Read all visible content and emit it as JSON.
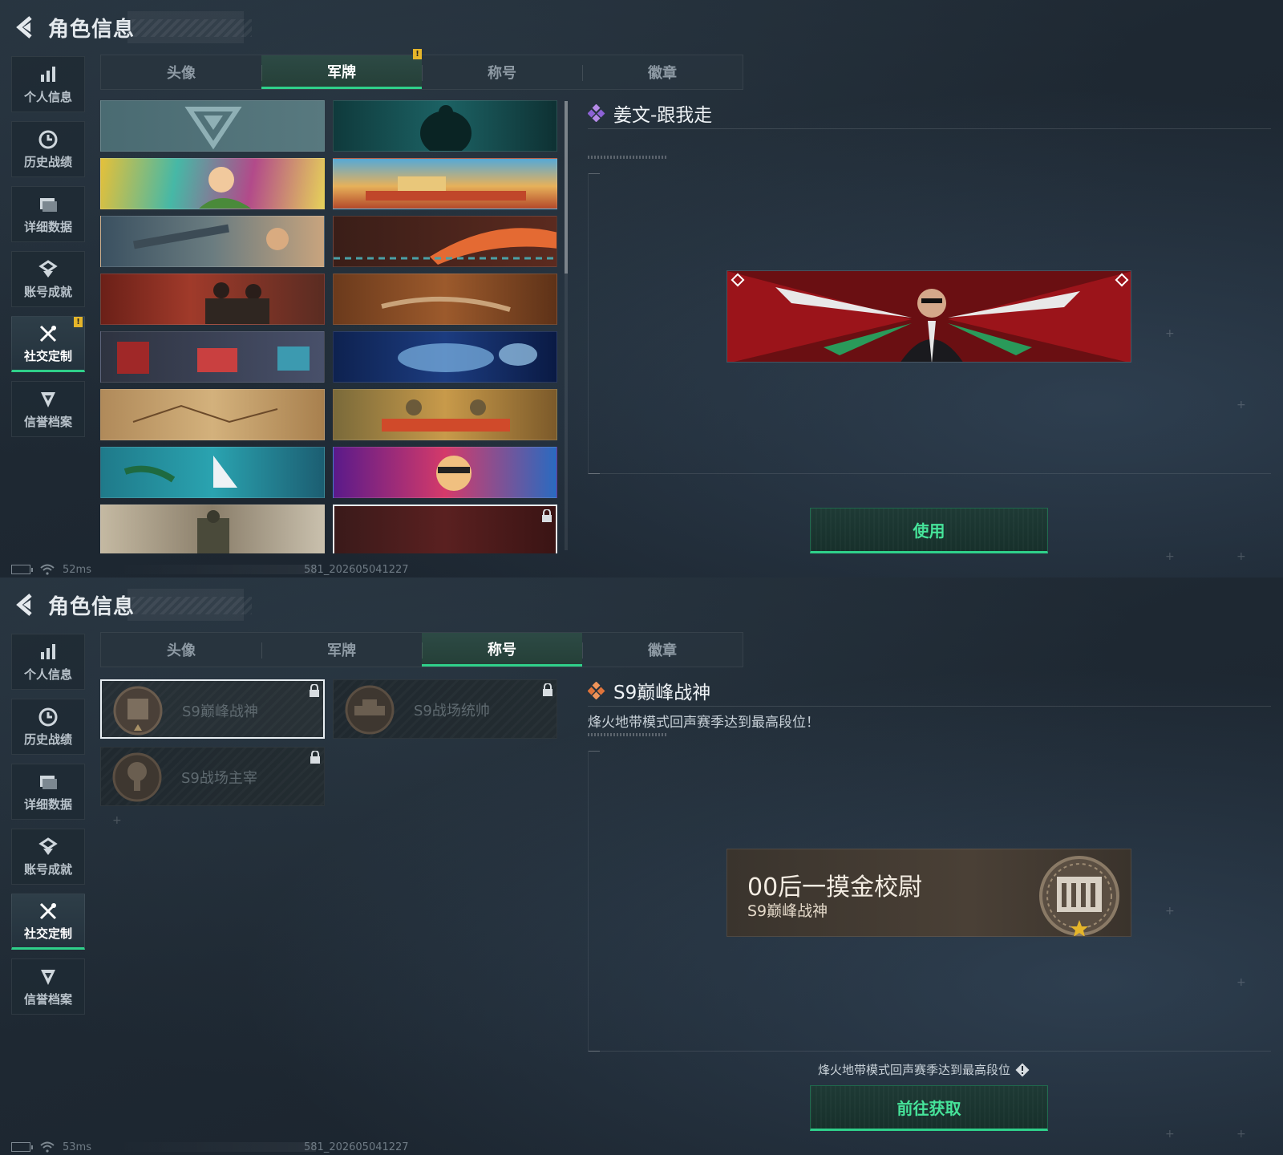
{
  "screens": [
    {
      "header": {
        "title": "角色信息"
      },
      "sidebar": [
        "个人信息",
        "历史战绩",
        "详细数据",
        "账号成就",
        "社交定制",
        "信誉档案"
      ],
      "tabs": [
        "头像",
        "军牌",
        "称号",
        "徽章"
      ],
      "active_tab": "军牌",
      "detail": {
        "name": "姜文-跟我走",
        "button": "使用"
      },
      "status": {
        "ping": "52ms",
        "build": "581_202605041227"
      }
    },
    {
      "header": {
        "title": "角色信息"
      },
      "sidebar": [
        "个人信息",
        "历史战绩",
        "详细数据",
        "账号成就",
        "社交定制",
        "信誉档案"
      ],
      "tabs": [
        "头像",
        "军牌",
        "称号",
        "徽章"
      ],
      "active_tab": "称号",
      "title_cards": [
        "S9巅峰战神",
        "S9战场统帅",
        "S9战场主宰"
      ],
      "detail": {
        "name": "S9巅峰战神",
        "description": "烽火地带模式回声赛季达到最高段位！",
        "preview_main": "00后一摸金校尉",
        "preview_sub": "S9巅峰战神",
        "hint": "烽火地带模式回声赛季达到最高段位",
        "button": "前往获取"
      },
      "status": {
        "ping": "53ms",
        "build": "581_202605041227"
      }
    }
  ],
  "colors": {
    "accent_green": "#2fd08a",
    "notice_yellow": "#e5b52a"
  }
}
